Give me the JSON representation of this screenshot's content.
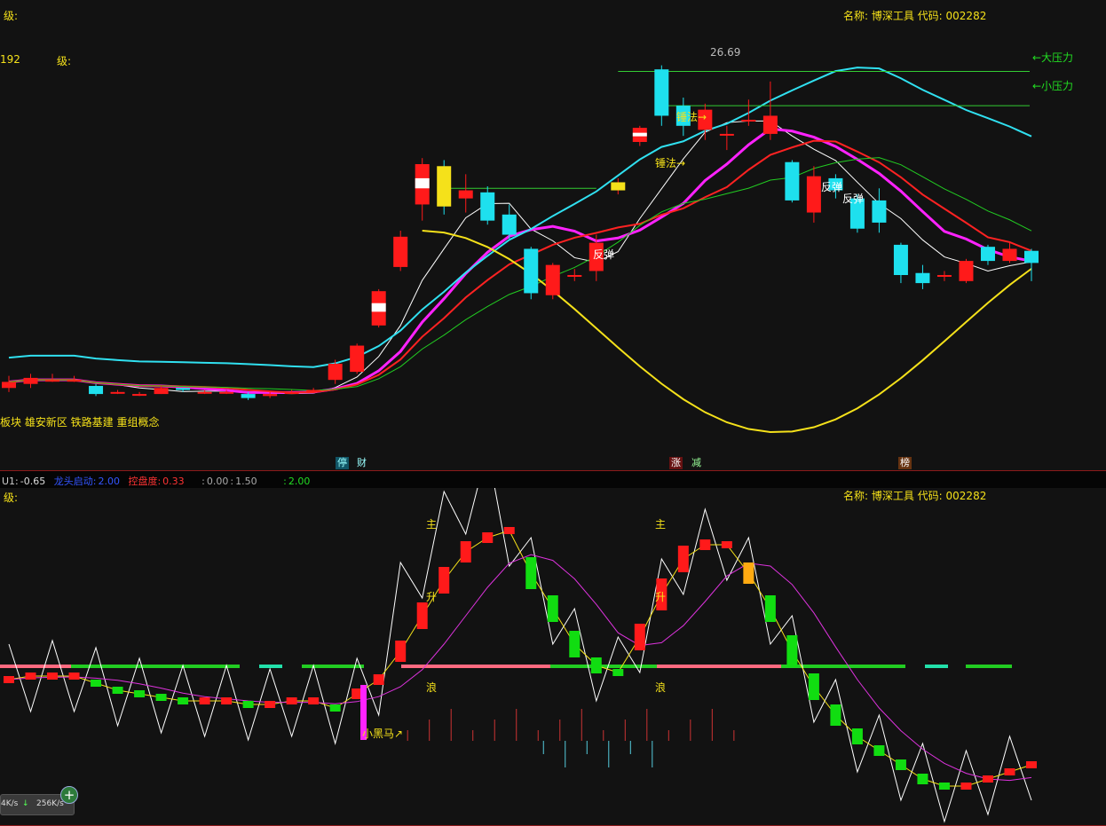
{
  "top": {
    "level_label": "级:",
    "level_label2": "级:",
    "left_num": "192",
    "stock": "名称: 博深工具  代码: 002282",
    "price_label": "26.69",
    "big_pressure": "←大压力",
    "small_pressure": "←小压力",
    "sectors": "板块 雄安新区 铁路基建 重组概念",
    "bottom_badges": [
      "停",
      "财",
      "涨",
      "减",
      "榜"
    ],
    "annotations": [
      "反弹",
      "锤法→",
      "锤法→",
      "反弹",
      "反弹"
    ],
    "colors": {
      "up": "#ff1a1a",
      "down": "#1ee0ee",
      "yellow": "#f5e11a",
      "magenta": "#ff22ff",
      "cyan": "#30e0f0"
    }
  },
  "separator": {
    "u1_label": "U1:",
    "u1_value": "-0.65",
    "long_label": "龙头启动:",
    "long_value": "2.00",
    "control_label": "控盘度:",
    "control_value": "0.33",
    "colon_a": ":",
    "ratio_a": "0.00",
    "ratio_b": "1.50",
    "colon_b": ":",
    "last_value": "2.00"
  },
  "bottom": {
    "level_label": "级:",
    "stock": "名称: 博深工具  代码: 002282",
    "zhu_1": "主",
    "sheng_1": "升",
    "lang_1": "浪",
    "zhu_2": "主",
    "sheng_2": "升",
    "lang_2": "浪",
    "xiaoheima": "小黑马↗"
  },
  "net": {
    "down": "4K/s",
    "up": "256K/s",
    "add_icon": "+"
  },
  "chart_data": [
    {
      "type": "candlestick",
      "title": "",
      "candles": [
        {
          "o": 11.2,
          "c": 11.5,
          "h": 11.8,
          "l": 11.0
        },
        {
          "o": 11.4,
          "c": 11.7,
          "h": 11.9,
          "l": 11.2
        },
        {
          "o": 11.6,
          "c": 11.6,
          "h": 11.9,
          "l": 11.5
        },
        {
          "o": 11.6,
          "c": 11.6,
          "h": 11.8,
          "l": 11.5
        },
        {
          "o": 11.3,
          "c": 10.9,
          "h": 11.4,
          "l": 10.8
        },
        {
          "o": 11.0,
          "c": 11.0,
          "h": 11.1,
          "l": 10.9
        },
        {
          "o": 10.9,
          "c": 10.9,
          "h": 11.0,
          "l": 10.8
        },
        {
          "o": 10.9,
          "c": 11.2,
          "h": 11.3,
          "l": 10.9
        },
        {
          "o": 11.2,
          "c": 11.1,
          "h": 11.2,
          "l": 11.0
        },
        {
          "o": 11.0,
          "c": 11.0,
          "h": 11.1,
          "l": 10.9
        },
        {
          "o": 11.0,
          "c": 11.0,
          "h": 11.1,
          "l": 10.9
        },
        {
          "o": 10.9,
          "c": 10.7,
          "h": 11.0,
          "l": 10.6
        },
        {
          "o": 10.8,
          "c": 10.9,
          "h": 11.0,
          "l": 10.7
        },
        {
          "o": 10.9,
          "c": 11.0,
          "h": 11.1,
          "l": 10.9
        },
        {
          "o": 11.0,
          "c": 11.1,
          "h": 11.2,
          "l": 11.0
        },
        {
          "o": 11.6,
          "c": 12.4,
          "h": 12.6,
          "l": 11.4
        },
        {
          "o": 12.0,
          "c": 13.3,
          "h": 13.4,
          "l": 11.9
        },
        {
          "o": 14.3,
          "c": 16.0,
          "h": 16.1,
          "l": 14.2
        },
        {
          "o": 17.2,
          "c": 18.7,
          "h": 19.0,
          "l": 17.0
        },
        {
          "o": 20.3,
          "c": 22.3,
          "h": 22.6,
          "l": 19.5
        },
        {
          "o": 22.2,
          "c": 20.2,
          "h": 22.5,
          "l": 19.8
        },
        {
          "o": 20.6,
          "c": 21.0,
          "h": 21.8,
          "l": 19.9
        },
        {
          "o": 20.9,
          "c": 19.5,
          "h": 21.2,
          "l": 19.3
        },
        {
          "o": 19.8,
          "c": 18.8,
          "h": 20.3,
          "l": 18.6
        },
        {
          "o": 18.1,
          "c": 15.9,
          "h": 18.2,
          "l": 15.6
        },
        {
          "o": 15.8,
          "c": 17.3,
          "h": 17.4,
          "l": 15.6
        },
        {
          "o": 16.8,
          "c": 16.8,
          "h": 17.1,
          "l": 16.5
        },
        {
          "o": 17.0,
          "c": 18.4,
          "h": 18.8,
          "l": 16.5
        },
        {
          "o": 21.0,
          "c": 21.4,
          "h": 21.6,
          "l": 20.8
        },
        {
          "o": 23.4,
          "c": 24.1,
          "h": 24.2,
          "l": 23.2
        },
        {
          "o": 27.0,
          "c": 24.7,
          "h": 27.2,
          "l": 24.2
        },
        {
          "o": 25.2,
          "c": 24.2,
          "h": 25.6,
          "l": 23.7
        },
        {
          "o": 24.0,
          "c": 25.0,
          "h": 25.3,
          "l": 23.5
        },
        {
          "o": 23.8,
          "c": 23.8,
          "h": 24.2,
          "l": 23.0
        },
        {
          "o": 24.5,
          "c": 24.5,
          "h": 25.5,
          "l": 24.2
        },
        {
          "o": 23.8,
          "c": 24.7,
          "h": 26.4,
          "l": 23.5
        },
        {
          "o": 22.4,
          "c": 20.5,
          "h": 22.5,
          "l": 20.4
        },
        {
          "o": 19.9,
          "c": 21.7,
          "h": 22.2,
          "l": 19.4
        },
        {
          "o": 21.6,
          "c": 21.0,
          "h": 21.8,
          "l": 20.6
        },
        {
          "o": 20.6,
          "c": 19.1,
          "h": 20.8,
          "l": 18.9
        },
        {
          "o": 20.5,
          "c": 19.4,
          "h": 21.1,
          "l": 18.9
        },
        {
          "o": 18.3,
          "c": 16.8,
          "h": 18.4,
          "l": 16.4
        },
        {
          "o": 16.9,
          "c": 16.4,
          "h": 17.3,
          "l": 16.1
        },
        {
          "o": 16.8,
          "c": 16.8,
          "h": 17.0,
          "l": 16.5
        },
        {
          "o": 16.5,
          "c": 17.5,
          "h": 17.6,
          "l": 16.4
        },
        {
          "o": 18.2,
          "c": 17.5,
          "h": 18.3,
          "l": 17.3
        },
        {
          "o": 17.5,
          "c": 18.1,
          "h": 18.4,
          "l": 17.4
        },
        {
          "o": 18.0,
          "c": 17.4,
          "h": 18.1,
          "l": 16.5
        }
      ],
      "ylim": [
        8,
        30
      ]
    },
    {
      "type": "bar",
      "title": "",
      "values": [
        -4,
        -3,
        -3,
        -3,
        -5,
        -7,
        -8,
        -9,
        -10,
        -10,
        -10,
        -11,
        -11,
        -10,
        -10,
        -12,
        -8,
        -4,
        4,
        14,
        24,
        32,
        36,
        38,
        26,
        16,
        6,
        0,
        -2,
        8,
        20,
        30,
        34,
        34,
        26,
        16,
        4,
        -6,
        -14,
        -20,
        -24,
        -28,
        -32,
        -34,
        -34,
        -32,
        -30,
        -28
      ],
      "ylim": [
        -40,
        45
      ]
    }
  ]
}
